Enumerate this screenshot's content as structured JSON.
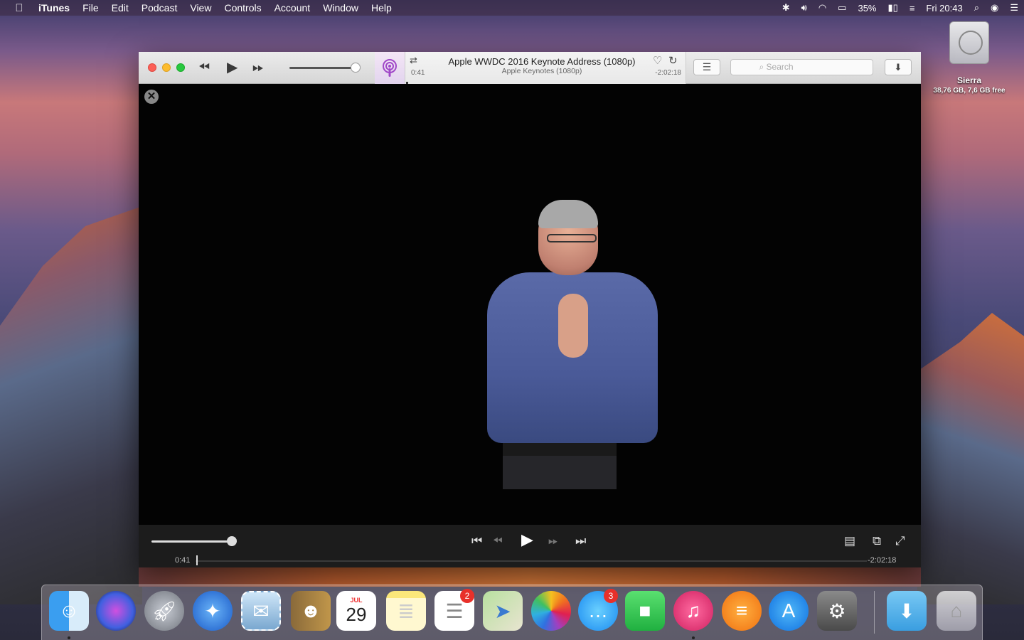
{
  "menubar": {
    "app": "iTunes",
    "items": [
      "File",
      "Edit",
      "Podcast",
      "View",
      "Controls",
      "Account",
      "Window",
      "Help"
    ],
    "battery": "35%",
    "clock": "Fri 20:43"
  },
  "desktop": {
    "disk_name": "Sierra",
    "disk_info": "38,76 GB, 7,6 GB free"
  },
  "toolbar": {
    "title": "Apple WWDC 2016 Keynote Address (1080p)",
    "subtitle": "Apple Keynotes (1080p)",
    "elapsed": "0:41",
    "remaining": "-2:02:18",
    "search_placeholder": "Search",
    "volume_level": 0.92
  },
  "player": {
    "elapsed": "0:41",
    "remaining": "-2:02:18",
    "volume_level": 1.0,
    "progress": 0.006
  },
  "dock": {
    "calendar_month": "JUL",
    "calendar_day": "29",
    "reminders_badge": "2",
    "messages_badge": "3",
    "apps": [
      "Finder",
      "Siri",
      "Launchpad",
      "Safari",
      "Mail",
      "Contacts",
      "Calendar",
      "Notes",
      "Reminders",
      "Maps",
      "Photos",
      "Messages",
      "FaceTime",
      "iTunes",
      "iBooks",
      "App Store",
      "System Preferences",
      "Downloads",
      "Trash"
    ]
  }
}
